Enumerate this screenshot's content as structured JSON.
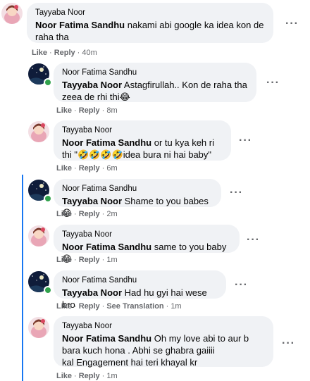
{
  "comments": [
    {
      "author": "Tayyaba Noor",
      "mention": "Noor Fatima Sandhu",
      "text": " nakami abi google ka idea kon de raha tha",
      "like": "Like",
      "reply": "Reply",
      "time": "40m",
      "avatar": "girl-avatar"
    },
    {
      "author": "Noor Fatima Sandhu",
      "mention": "Tayyaba Noor",
      "text": " Astagfirullah.. Kon de raha tha zeea de rhi thi😂",
      "like": "Like",
      "reply": "Reply",
      "time": "8m",
      "avatar": "night-sky-avatar"
    },
    {
      "author": "Tayyaba Noor",
      "mention": "Noor Fatima Sandhu",
      "text": " or tu kya keh ri thi \"🤣🤣🤣🤣idea bura ni hai baby\"",
      "like": "Like",
      "reply": "Reply",
      "time": "6m",
      "avatar": "girl-avatar"
    },
    {
      "author": "Noor Fatima Sandhu",
      "mention": "Tayyaba Noor",
      "text": " Shame to you babes😁",
      "like": "Like",
      "reply": "Reply",
      "time": "2m",
      "avatar": "night-sky-avatar"
    },
    {
      "author": "Tayyaba Noor",
      "mention": "Noor Fatima Sandhu",
      "text": " same to you baby😁",
      "like": "Like",
      "reply": "Reply",
      "time": "1m",
      "avatar": "girl-avatar"
    },
    {
      "author": "Noor Fatima Sandhu",
      "mention": "Tayyaba Noor",
      "text": " Had hu gyi hai wese bro",
      "like": "Like",
      "reply": "Reply",
      "see_translation": "See Translation",
      "time": "1m",
      "avatar": "night-sky-avatar"
    },
    {
      "author": "Tayyaba Noor",
      "mention": "Noor Fatima Sandhu",
      "text": " Oh my love abi to aur b bara kuch hona . Abhi se ghabra gaiiii",
      "text2": "kal Engagement hai teri khayal kr",
      "like": "Like",
      "reply": "Reply",
      "time": "1m",
      "avatar": "girl-avatar"
    }
  ],
  "more_glyph": "···",
  "colors": {
    "bubble": "#f0f2f5",
    "meta": "#65676b",
    "thread_line": "#1877f2",
    "online": "#31a24c"
  }
}
